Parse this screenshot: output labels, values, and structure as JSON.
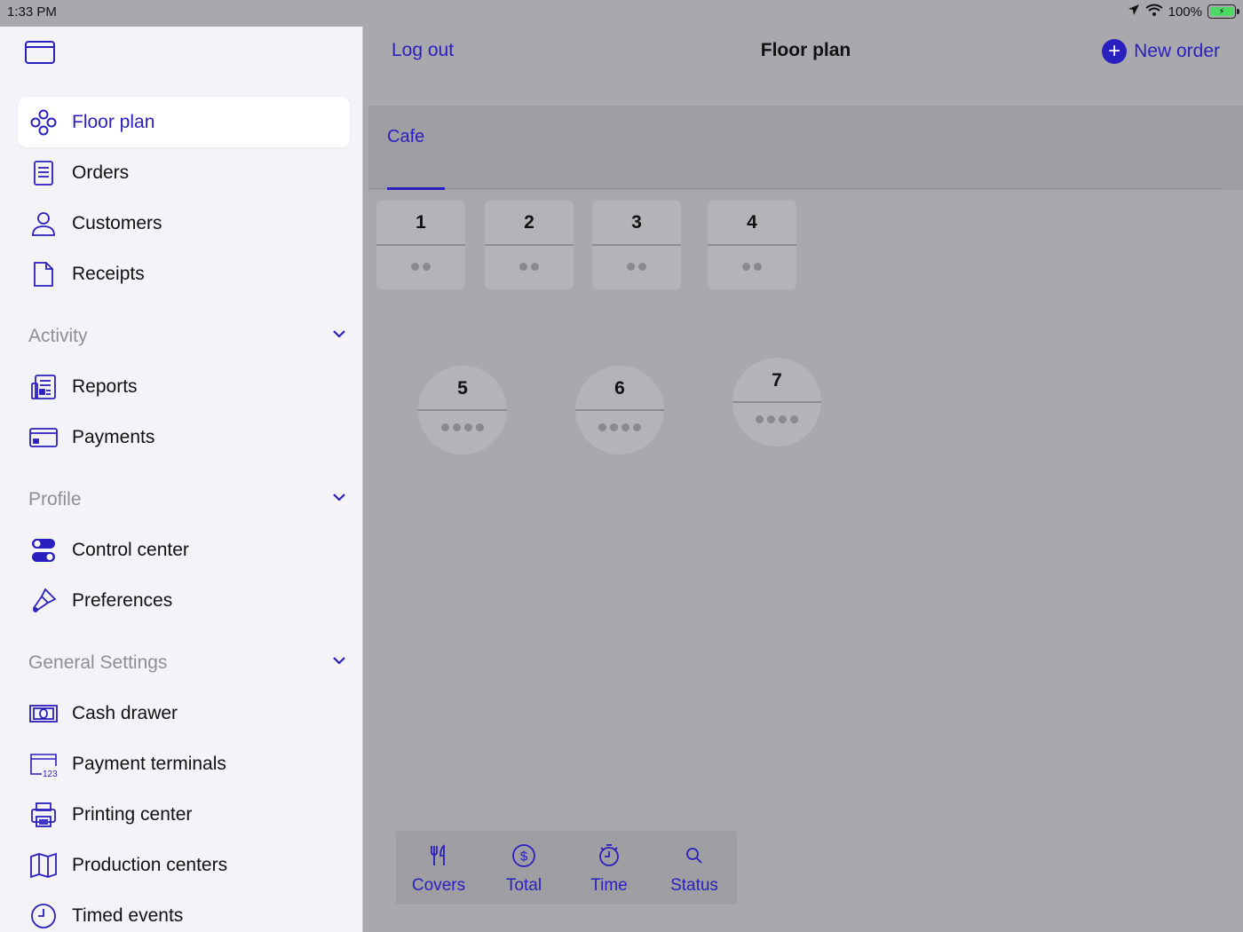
{
  "status_bar": {
    "time": "1:33 PM",
    "battery": "100%"
  },
  "sidebar": {
    "items": [
      {
        "label": "Floor plan",
        "icon": "floor-plan-icon",
        "selected": true
      },
      {
        "label": "Orders",
        "icon": "orders-icon"
      },
      {
        "label": "Customers",
        "icon": "customers-icon"
      },
      {
        "label": "Receipts",
        "icon": "receipts-icon"
      }
    ],
    "sections": [
      {
        "title": "Activity",
        "items": [
          {
            "label": "Reports",
            "icon": "reports-icon"
          },
          {
            "label": "Payments",
            "icon": "payments-icon"
          }
        ]
      },
      {
        "title": "Profile",
        "items": [
          {
            "label": "Control center",
            "icon": "control-center-icon"
          },
          {
            "label": "Preferences",
            "icon": "preferences-icon"
          }
        ]
      },
      {
        "title": "General Settings",
        "items": [
          {
            "label": "Cash drawer",
            "icon": "cash-drawer-icon"
          },
          {
            "label": "Payment terminals",
            "icon": "payment-terminals-icon"
          },
          {
            "label": "Printing center",
            "icon": "printing-center-icon"
          },
          {
            "label": "Production centers",
            "icon": "production-centers-icon"
          },
          {
            "label": "Timed events",
            "icon": "timed-events-icon"
          }
        ]
      }
    ]
  },
  "navbar": {
    "logout": "Log out",
    "title": "Floor plan",
    "new_order": "New order"
  },
  "floor": {
    "tab": "Cafe",
    "tables": [
      {
        "number": "1",
        "shape": "square",
        "seats": 2
      },
      {
        "number": "2",
        "shape": "square",
        "seats": 2
      },
      {
        "number": "3",
        "shape": "square",
        "seats": 2
      },
      {
        "number": "4",
        "shape": "square",
        "seats": 2
      },
      {
        "number": "5",
        "shape": "round",
        "seats": 4
      },
      {
        "number": "6",
        "shape": "round",
        "seats": 4
      },
      {
        "number": "7",
        "shape": "round",
        "seats": 4
      }
    ]
  },
  "bottom_bar": [
    {
      "label": "Covers",
      "icon": "fork-knife-icon"
    },
    {
      "label": "Total",
      "icon": "dollar-circle-icon"
    },
    {
      "label": "Time",
      "icon": "stopwatch-icon"
    },
    {
      "label": "Status",
      "icon": "search-icon"
    }
  ],
  "colors": {
    "accent": "#2a1fbf",
    "sidebar_bg": "#f4f3f8",
    "main_bg": "#a9a8ad"
  }
}
